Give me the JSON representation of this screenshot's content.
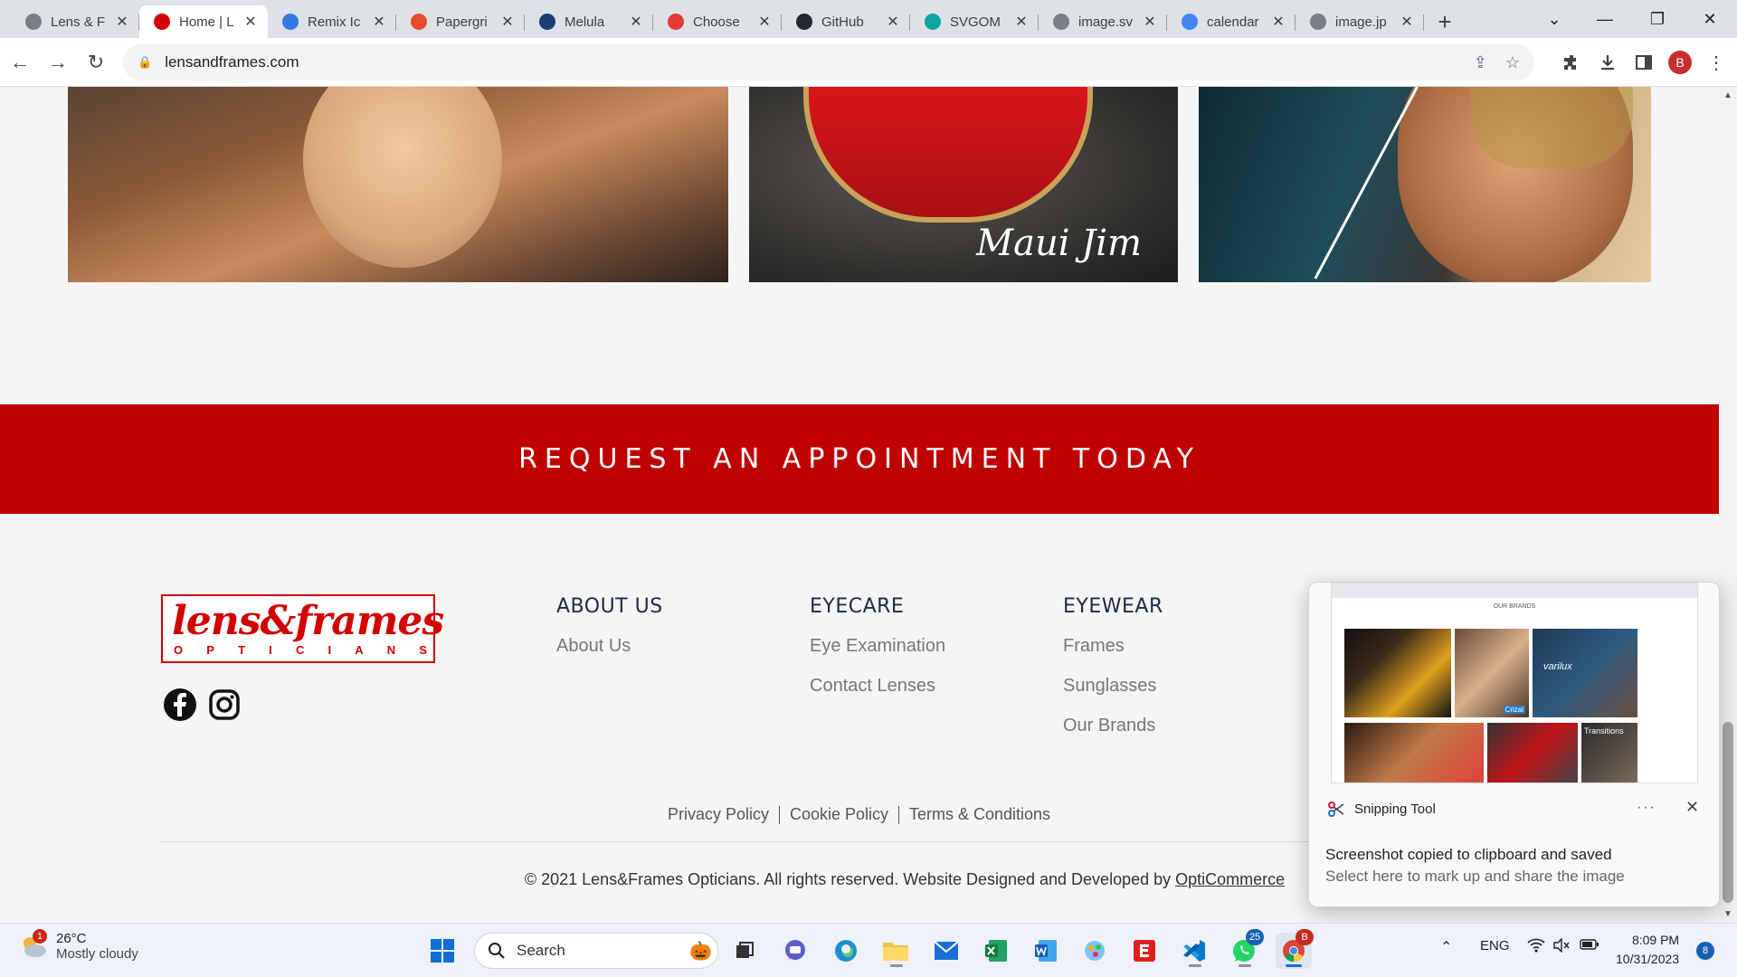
{
  "browser": {
    "tabs": [
      {
        "title": "Lens & F",
        "favicon": "globe-icon",
        "color": "#7b7f85"
      },
      {
        "title": "Home | L",
        "favicon": "lens-frames-icon",
        "color": "#d40000",
        "active": true
      },
      {
        "title": "Remix Ic",
        "favicon": "remix-icon",
        "color": "#3578e5"
      },
      {
        "title": "Papergri",
        "favicon": "papergrid-icon",
        "color": "#e54b2c"
      },
      {
        "title": "Melula",
        "favicon": "melula-icon",
        "color": "#1d3c78"
      },
      {
        "title": "Choose",
        "favicon": "choose-icon",
        "color": "#e53935"
      },
      {
        "title": "GitHub",
        "favicon": "github-icon",
        "color": "#24292f"
      },
      {
        "title": "SVGOM",
        "favicon": "svgomg-icon",
        "color": "#0aa5a1"
      },
      {
        "title": "image.sv",
        "favicon": "globe-icon",
        "color": "#7b7f85"
      },
      {
        "title": "calendar",
        "favicon": "google-icon",
        "color": "#4285f4"
      },
      {
        "title": "image.jp",
        "favicon": "globe-icon",
        "color": "#7b7f85"
      }
    ],
    "new_tab": "+",
    "url": "lensandframes.com",
    "profile_initial": "B"
  },
  "page": {
    "photo_brand": "Maui Jim",
    "cta": "REQUEST AN APPOINTMENT TODAY",
    "logo": {
      "main": "lens&frames",
      "sub": [
        "O",
        "P",
        "T",
        "I",
        "C",
        "I",
        "A",
        "N",
        "S"
      ]
    },
    "columns": [
      {
        "heading": "ABOUT US",
        "links": [
          "About Us"
        ]
      },
      {
        "heading": "EYECARE",
        "links": [
          "Eye Examination",
          "Contact Lenses"
        ]
      },
      {
        "heading": "EYEWEAR",
        "links": [
          "Frames",
          "Sunglasses",
          "Our Brands"
        ]
      }
    ],
    "legal": [
      "Privacy Policy",
      "Cookie Policy",
      "Terms & Conditions"
    ],
    "copyright": "© 2021 Lens&Frames Opticians. All rights reserved. Website Designed and Developed by",
    "developer": "OptiCommerce"
  },
  "snip": {
    "thumb_heading": "OUR BRANDS",
    "thumb_captions": [
      "Crizal",
      "varilux",
      "Transitions"
    ],
    "app": "Snipping Tool",
    "more": "···",
    "close": "✕",
    "message": "Screenshot copied to clipboard and saved",
    "hint": "Select here to mark up and share the image"
  },
  "taskbar": {
    "temperature": "26°C",
    "condition": "Mostly cloudy",
    "weather_badge": "1",
    "search": "Search",
    "whatsapp_count": "25",
    "chrome_badge": "B",
    "language": "ENG",
    "time": "8:09 PM",
    "date": "10/31/2023",
    "notifications": "8"
  }
}
